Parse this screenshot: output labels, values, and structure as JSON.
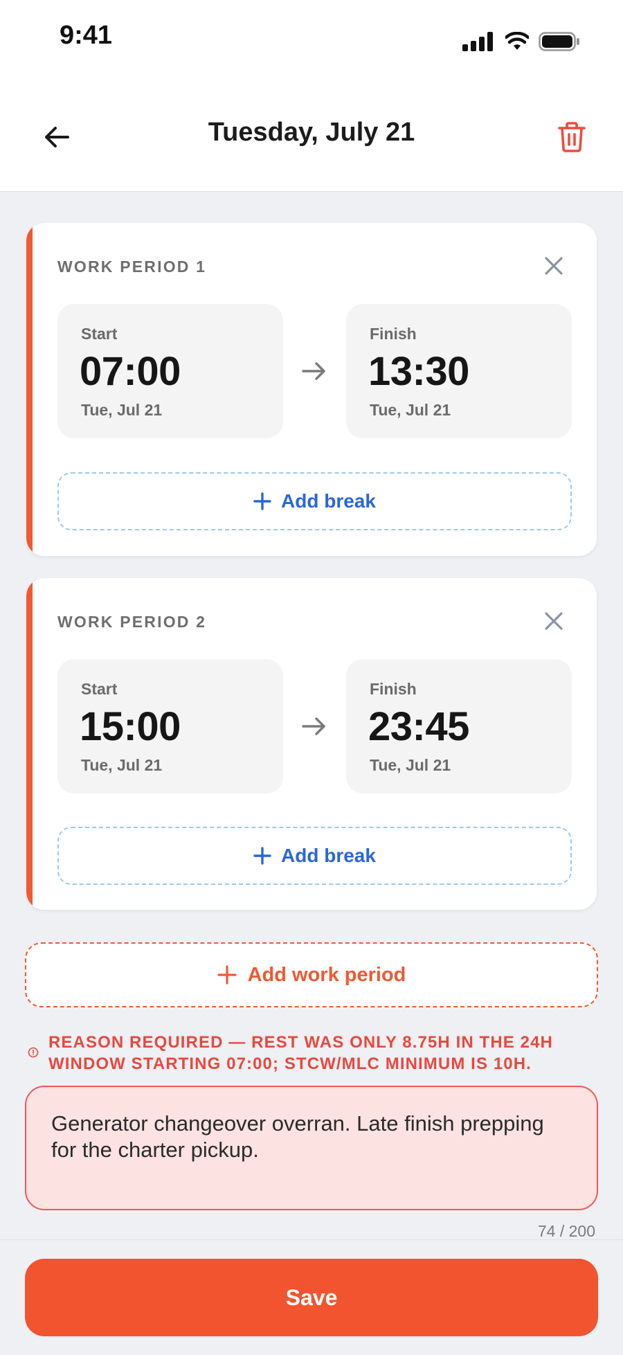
{
  "status_bar": {
    "time": "9:41"
  },
  "header": {
    "title": "Tuesday, July 21"
  },
  "periods": [
    {
      "title": "WORK PERIOD 1",
      "start": {
        "label": "Start",
        "time": "07:00",
        "date": "Tue, Jul 21"
      },
      "finish": {
        "label": "Finish",
        "time": "13:30",
        "date": "Tue, Jul 21"
      },
      "add_break": "Add break"
    },
    {
      "title": "WORK PERIOD 2",
      "start": {
        "label": "Start",
        "time": "15:00",
        "date": "Tue, Jul 21"
      },
      "finish": {
        "label": "Finish",
        "time": "23:45",
        "date": "Tue, Jul 21"
      },
      "add_break": "Add break"
    }
  ],
  "add_work_period": "Add work period",
  "warning": "REASON REQUIRED — REST WAS ONLY 8.75H IN THE 24H WINDOW STARTING 07:00; STCW/MLC MINIMUM IS 10H.",
  "reason": {
    "value": "Generator changeover overran. Late finish prepping for the charter pickup.",
    "counter": "74 / 200"
  },
  "save_label": "Save",
  "colors": {
    "accent": "#f2542f",
    "link_blue": "#2a66d9",
    "error_red": "#e8483f"
  }
}
